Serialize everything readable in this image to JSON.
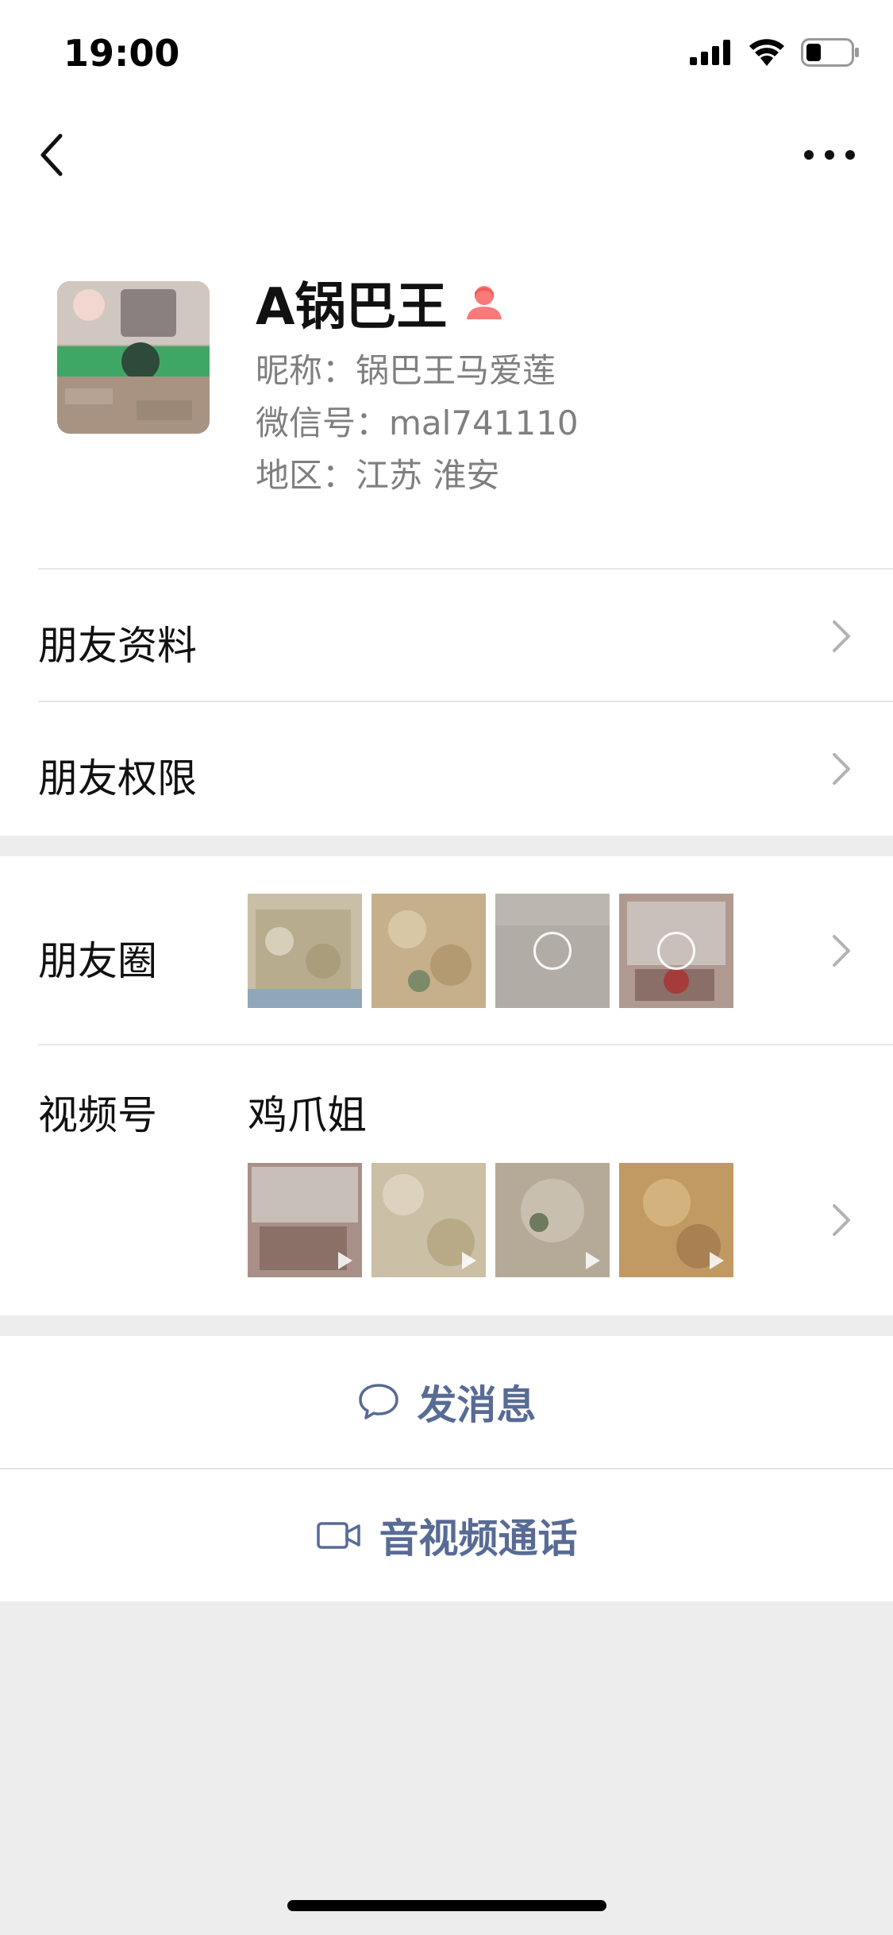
{
  "status_bar": {
    "time": "19:00",
    "battery_level": 0.3
  },
  "profile": {
    "name": "A锅巴王",
    "gender_icon": "female-user-icon",
    "nickname": "昵称：锅巴王马爱莲",
    "wechat_id": "微信号：mal741110",
    "region": "地区：江苏 淮安"
  },
  "cells": {
    "friend_profile": "朋友资料",
    "friend_permissions": "朋友权限",
    "moments": "朋友圈",
    "channels": "视频号",
    "channels_name": "鸡爪姐"
  },
  "actions": {
    "send_message": "发消息",
    "video_call": "音视频通话"
  },
  "colors": {
    "link": "#576b95",
    "background": "#ededed",
    "gender_icon": "#fa7979"
  }
}
